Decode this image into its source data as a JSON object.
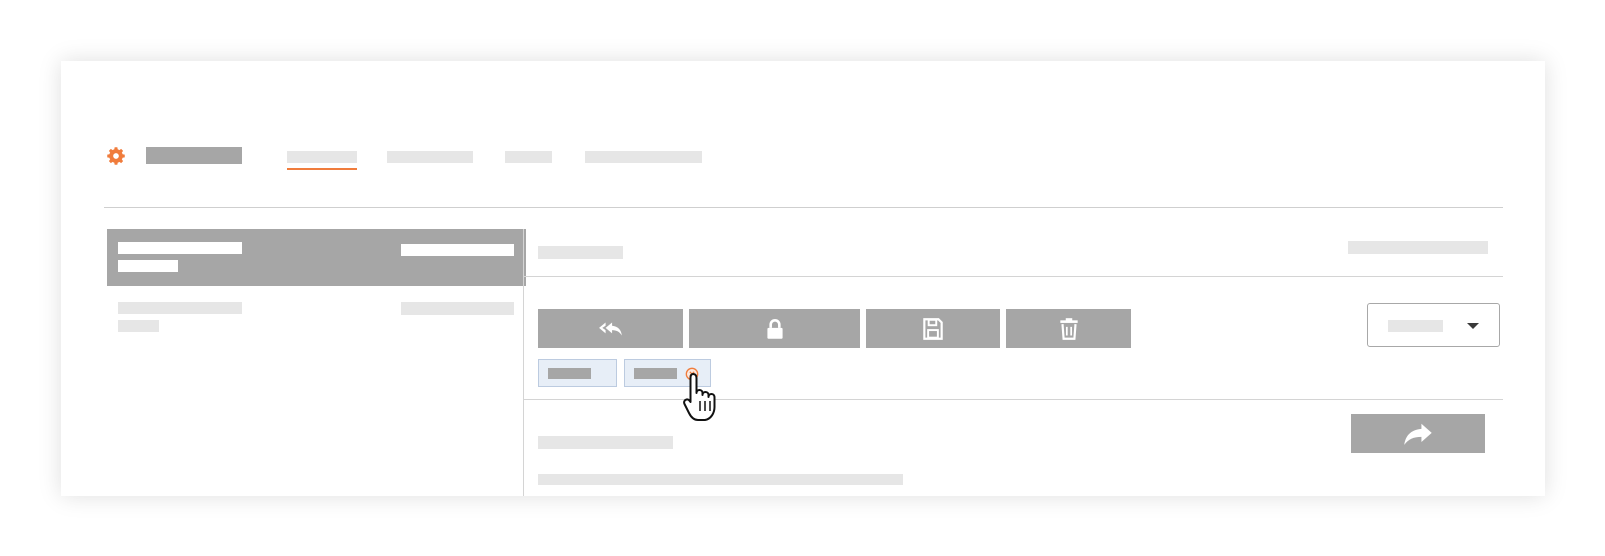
{
  "colors": {
    "accent": "#f07c3c",
    "placeholder_dark": "#a6a6a6",
    "placeholder_light": "#e6e6e6",
    "chip_bg": "#e7eef7",
    "chip_border": "#bccbe0",
    "selected_row": "#a6a6a6",
    "divider": "#d4d4d4"
  },
  "header": {
    "logo_icon": "gear-icon",
    "title": "",
    "tabs": [
      {
        "label": "",
        "active": true
      },
      {
        "label": "",
        "active": false
      },
      {
        "label": "",
        "active": false
      },
      {
        "label": "",
        "active": false
      }
    ]
  },
  "list": {
    "items": [
      {
        "title": "",
        "subtitle": "",
        "meta": "",
        "selected": true
      },
      {
        "title": "",
        "subtitle": "",
        "meta": "",
        "selected": false
      }
    ]
  },
  "detail": {
    "title": "",
    "meta": "",
    "actions": [
      {
        "icon": "reply-all-icon",
        "label": ""
      },
      {
        "icon": "lock-icon",
        "label": ""
      },
      {
        "icon": "save-icon",
        "label": ""
      },
      {
        "icon": "trash-icon",
        "label": ""
      }
    ],
    "dropdown": {
      "value": "",
      "icon": "caret-down-icon"
    },
    "chips": [
      {
        "label": "",
        "removable": false
      },
      {
        "label": "",
        "removable": true,
        "remove_icon": "remove-circle-icon"
      }
    ],
    "forward": {
      "icon": "forward-icon",
      "label": ""
    },
    "body": {
      "heading": "",
      "line": ""
    }
  },
  "cursor_icon": "hand-pointer-icon"
}
